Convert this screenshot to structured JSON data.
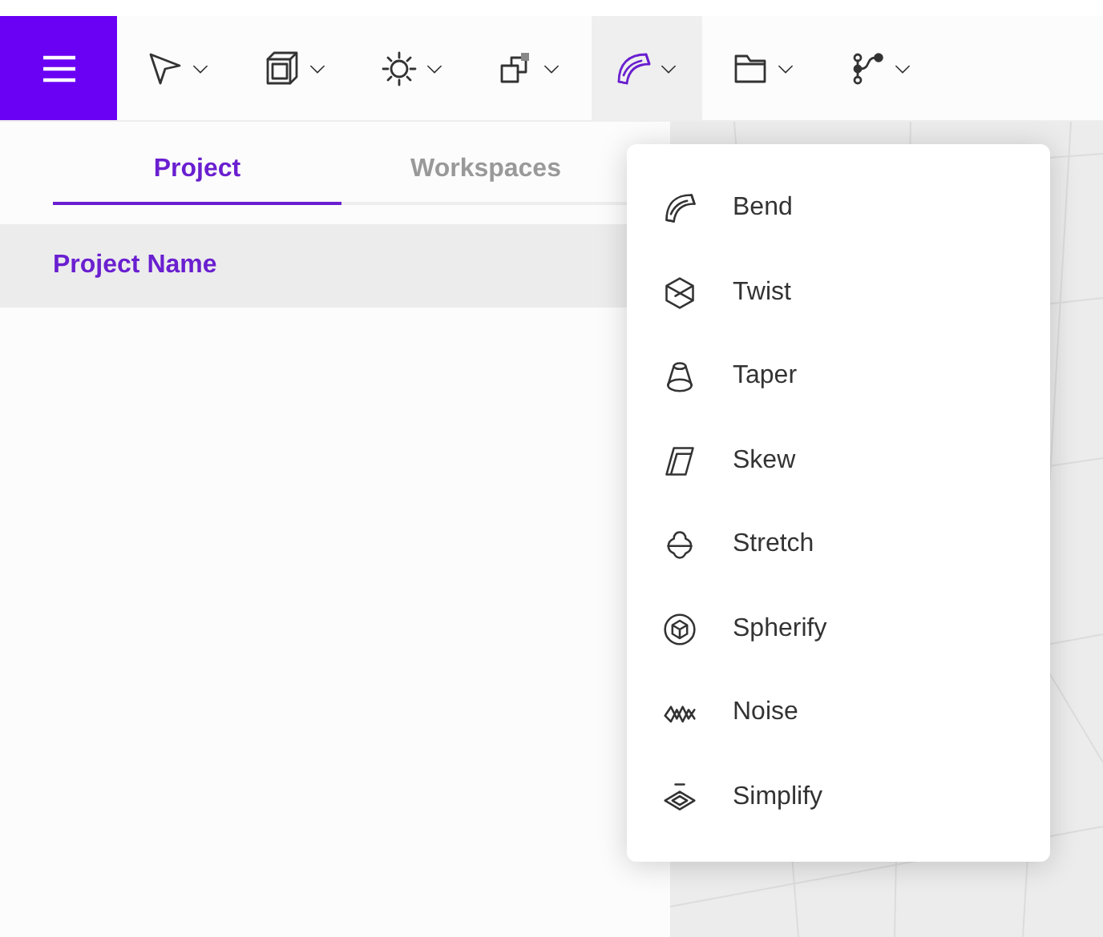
{
  "toolbar": {
    "menu_button": {
      "selected": true
    },
    "tools": [
      {
        "kind": "pointer",
        "selected": false
      },
      {
        "kind": "cube",
        "selected": false
      },
      {
        "kind": "light",
        "selected": false
      },
      {
        "kind": "instance",
        "selected": false
      },
      {
        "kind": "bend",
        "selected": true
      },
      {
        "kind": "folder",
        "selected": false
      },
      {
        "kind": "path",
        "selected": false
      }
    ]
  },
  "tabs": [
    {
      "label": "Project",
      "selected": true
    },
    {
      "label": "Workspaces",
      "selected": false
    }
  ],
  "projects": [
    {
      "name": "Project Name",
      "selected": true
    }
  ],
  "deform_menu": [
    {
      "kind": "bend",
      "label": "Bend"
    },
    {
      "kind": "twist",
      "label": "Twist"
    },
    {
      "kind": "taper",
      "label": "Taper"
    },
    {
      "kind": "skew",
      "label": "Skew"
    },
    {
      "kind": "stretch",
      "label": "Stretch"
    },
    {
      "kind": "spherify",
      "label": "Spherify"
    },
    {
      "kind": "noise",
      "label": "Noise"
    },
    {
      "kind": "simplify",
      "label": "Simplify"
    }
  ]
}
